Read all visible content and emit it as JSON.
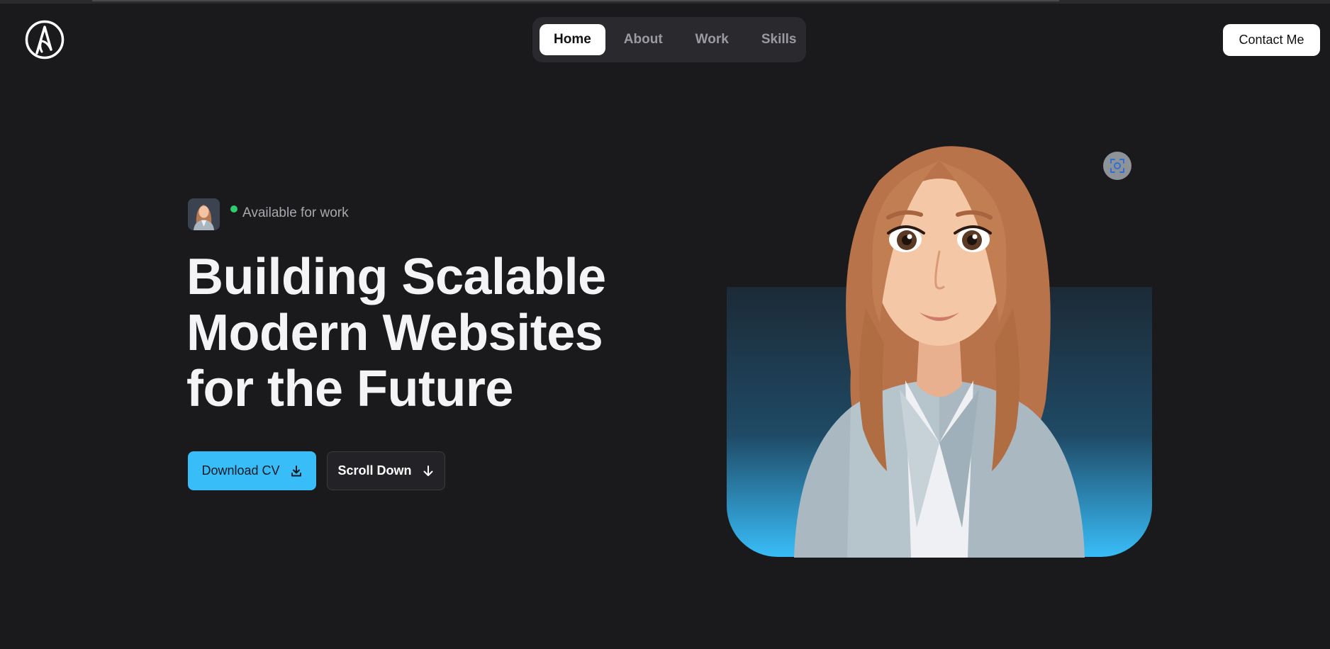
{
  "header": {
    "logo_icon": "letter-a-circle-logo",
    "nav": [
      {
        "label": "Home",
        "active": true
      },
      {
        "label": "About",
        "active": false
      },
      {
        "label": "Work",
        "active": false
      },
      {
        "label": "Skills",
        "active": false
      }
    ],
    "contact_label": "Contact Me"
  },
  "hero": {
    "availability": "Available for work",
    "status_color": "#2ecc71",
    "headline": [
      "Building Scalable",
      "Modern Websites",
      "for the Future"
    ],
    "download_label": "Download CV",
    "download_icon": "download-icon",
    "scroll_label": "Scroll Down",
    "scroll_icon": "arrow-down-icon",
    "accent": "#38bdf8",
    "image_action_icon": "scan-icon"
  }
}
